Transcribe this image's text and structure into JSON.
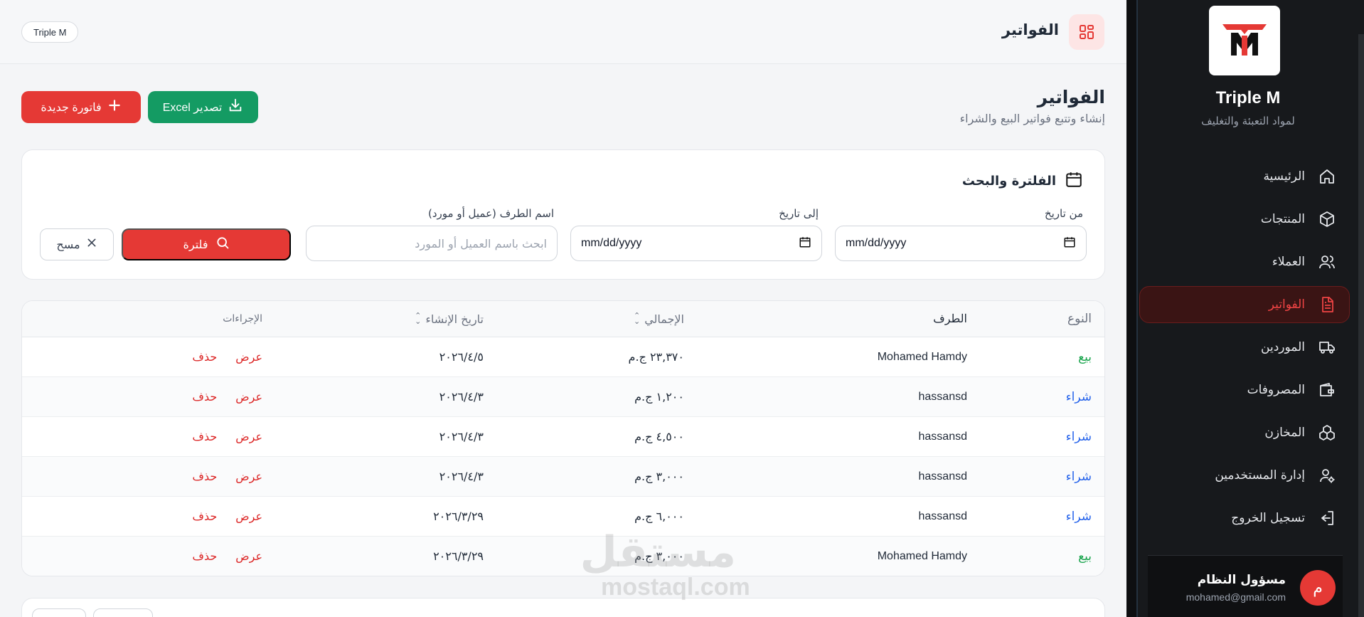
{
  "brand": {
    "name": "Triple M",
    "subtitle": "لمواد التعبئة والتغليف",
    "logo_text": "TM"
  },
  "nav": {
    "items": [
      {
        "label": "الرئيسية",
        "icon": "home-icon"
      },
      {
        "label": "المنتجات",
        "icon": "box-icon"
      },
      {
        "label": "العملاء",
        "icon": "users-icon"
      },
      {
        "label": "الفواتير",
        "icon": "document-icon",
        "active": true
      },
      {
        "label": "الموردين",
        "icon": "truck-icon"
      },
      {
        "label": "المصروفات",
        "icon": "wallet-icon"
      },
      {
        "label": "المخازن",
        "icon": "boxes-icon"
      },
      {
        "label": "إدارة المستخدمين",
        "icon": "user-settings-icon"
      },
      {
        "label": "تسجيل الخروج",
        "icon": "logout-icon"
      }
    ]
  },
  "user": {
    "initial": "م",
    "name": "مسؤول النظام",
    "email": "mohamed@gmail.com"
  },
  "topbar": {
    "title": "الفواتير",
    "chip": "Triple M"
  },
  "page": {
    "title": "الفواتير",
    "subtitle": "إنشاء وتتبع فواتير البيع والشراء",
    "new_invoice_label": "فاتورة جديدة",
    "export_label": "تصدير Excel"
  },
  "filter": {
    "title": "الفلترة والبحث",
    "from_label": "من تاريخ",
    "to_label": "إلى تاريخ",
    "party_label": "اسم الطرف (عميل أو مورد)",
    "date_placeholder": "mm/dd/yyyy",
    "party_placeholder": "ابحث باسم العميل أو المورد",
    "filter_button": "فلترة",
    "clear_button": "مسح"
  },
  "table": {
    "headers": {
      "type": "النوع",
      "party": "الطرف",
      "total": "الإجمالي",
      "date": "تاريخ الإنشاء",
      "actions": "الإجراءات"
    },
    "view_label": "عرض",
    "delete_label": "حذف",
    "rows": [
      {
        "type": "بيع",
        "kind": "sale",
        "party": "Mohamed Hamdy",
        "total": "٢٣,٣٧٠ ج.م",
        "date": "٢٠٢٦/٤/٥"
      },
      {
        "type": "شراء",
        "kind": "buy",
        "party": "hassansd",
        "total": "١,٢٠٠ ج.م",
        "date": "٢٠٢٦/٤/٣"
      },
      {
        "type": "شراء",
        "kind": "buy",
        "party": "hassansd",
        "total": "٤,٥٠٠ ج.م",
        "date": "٢٠٢٦/٤/٣"
      },
      {
        "type": "شراء",
        "kind": "buy",
        "party": "hassansd",
        "total": "٣,٠٠٠ ج.م",
        "date": "٢٠٢٦/٤/٣"
      },
      {
        "type": "شراء",
        "kind": "buy",
        "party": "hassansd",
        "total": "٦,٠٠٠ ج.م",
        "date": "٢٠٢٦/٣/٢٩"
      },
      {
        "type": "بيع",
        "kind": "sale",
        "party": "Mohamed Hamdy",
        "total": "٣,٠٠٠ ج.م",
        "date": "٢٠٢٦/٣/٢٩"
      }
    ]
  },
  "watermark": {
    "arabic": "مستقل",
    "latin": "mostaql.com"
  },
  "colors": {
    "accent": "#e53935",
    "success": "#149b63",
    "sidebar_bg": "#17191c",
    "sale": "#16a34a",
    "buy": "#2563eb"
  }
}
